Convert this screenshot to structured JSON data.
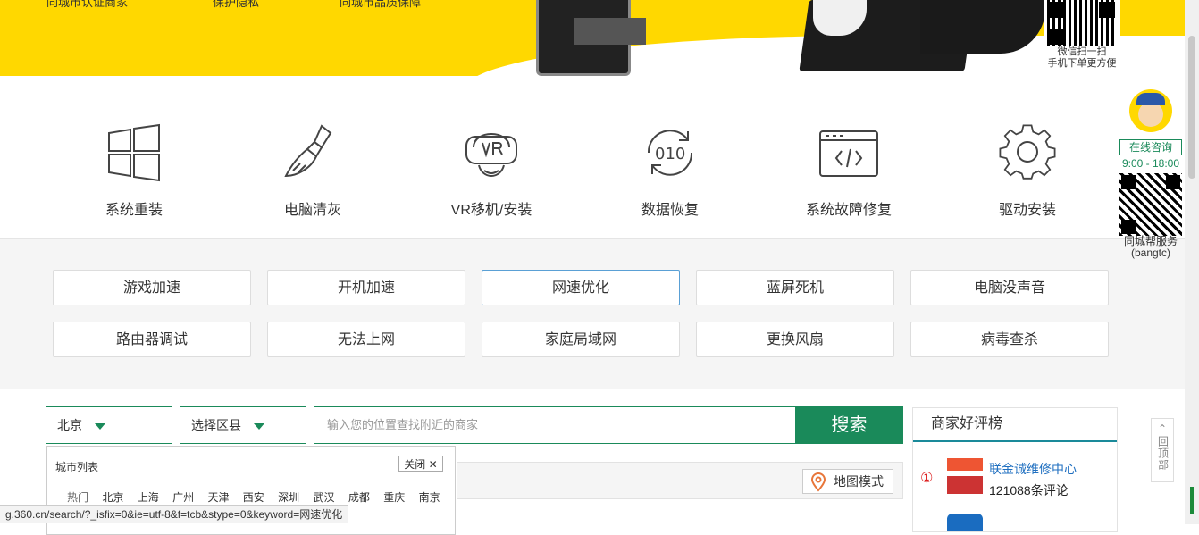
{
  "banner": {
    "text_left": "同城市认证商家",
    "text_mid": "保护隐私",
    "text_right": "同城市品质保障",
    "qr_caption_1": "微信扫一扫",
    "qr_caption_2": "手机下单更方便",
    "accent": "#ffd800"
  },
  "services": [
    {
      "label": "系统重装",
      "icon": "windows-icon"
    },
    {
      "label": "电脑清灰",
      "icon": "brush-icon"
    },
    {
      "label": "VR移机/安装",
      "icon": "vr-headset-icon"
    },
    {
      "label": "数据恢复",
      "icon": "data-recovery-icon"
    },
    {
      "label": "系统故障修复",
      "icon": "code-window-icon"
    },
    {
      "label": "驱动安装",
      "icon": "gear-icon"
    }
  ],
  "tags": {
    "row1": [
      "游戏加速",
      "开机加速",
      "网速优化",
      "蓝屏死机",
      "电脑没声音"
    ],
    "row2": [
      "路由器调试",
      "无法上网",
      "家庭局域网",
      "更换风扇",
      "病毒查杀"
    ],
    "active": "网速优化"
  },
  "search": {
    "city": "北京",
    "district": "选择区县",
    "placeholder": "输入您的位置查找附近的商家",
    "button": "搜索",
    "map_mode": "地图模式",
    "accent": "#1a8a5a"
  },
  "city_popup": {
    "title": "城市列表",
    "close": "关闭",
    "hot_label": "热门",
    "cities": [
      "北京",
      "上海",
      "广州",
      "天津",
      "西安",
      "深圳",
      "武汉",
      "成都",
      "重庆",
      "南京"
    ]
  },
  "ranking": {
    "title": "商家好评榜",
    "items": [
      {
        "rank": "①",
        "name": "联金诚维修中心",
        "reviews": "121088条评论"
      }
    ]
  },
  "sidebar": {
    "consult": "在线咨询",
    "hours": "9:00 - 18:00",
    "caption_1": "同城帮服务",
    "caption_2": "(bangtc)",
    "to_top": "回顶部"
  },
  "status_url": "g.360.cn/search/?_isfix=0&ie=utf-8&f=tcb&stype=0&keyword=网速优化"
}
